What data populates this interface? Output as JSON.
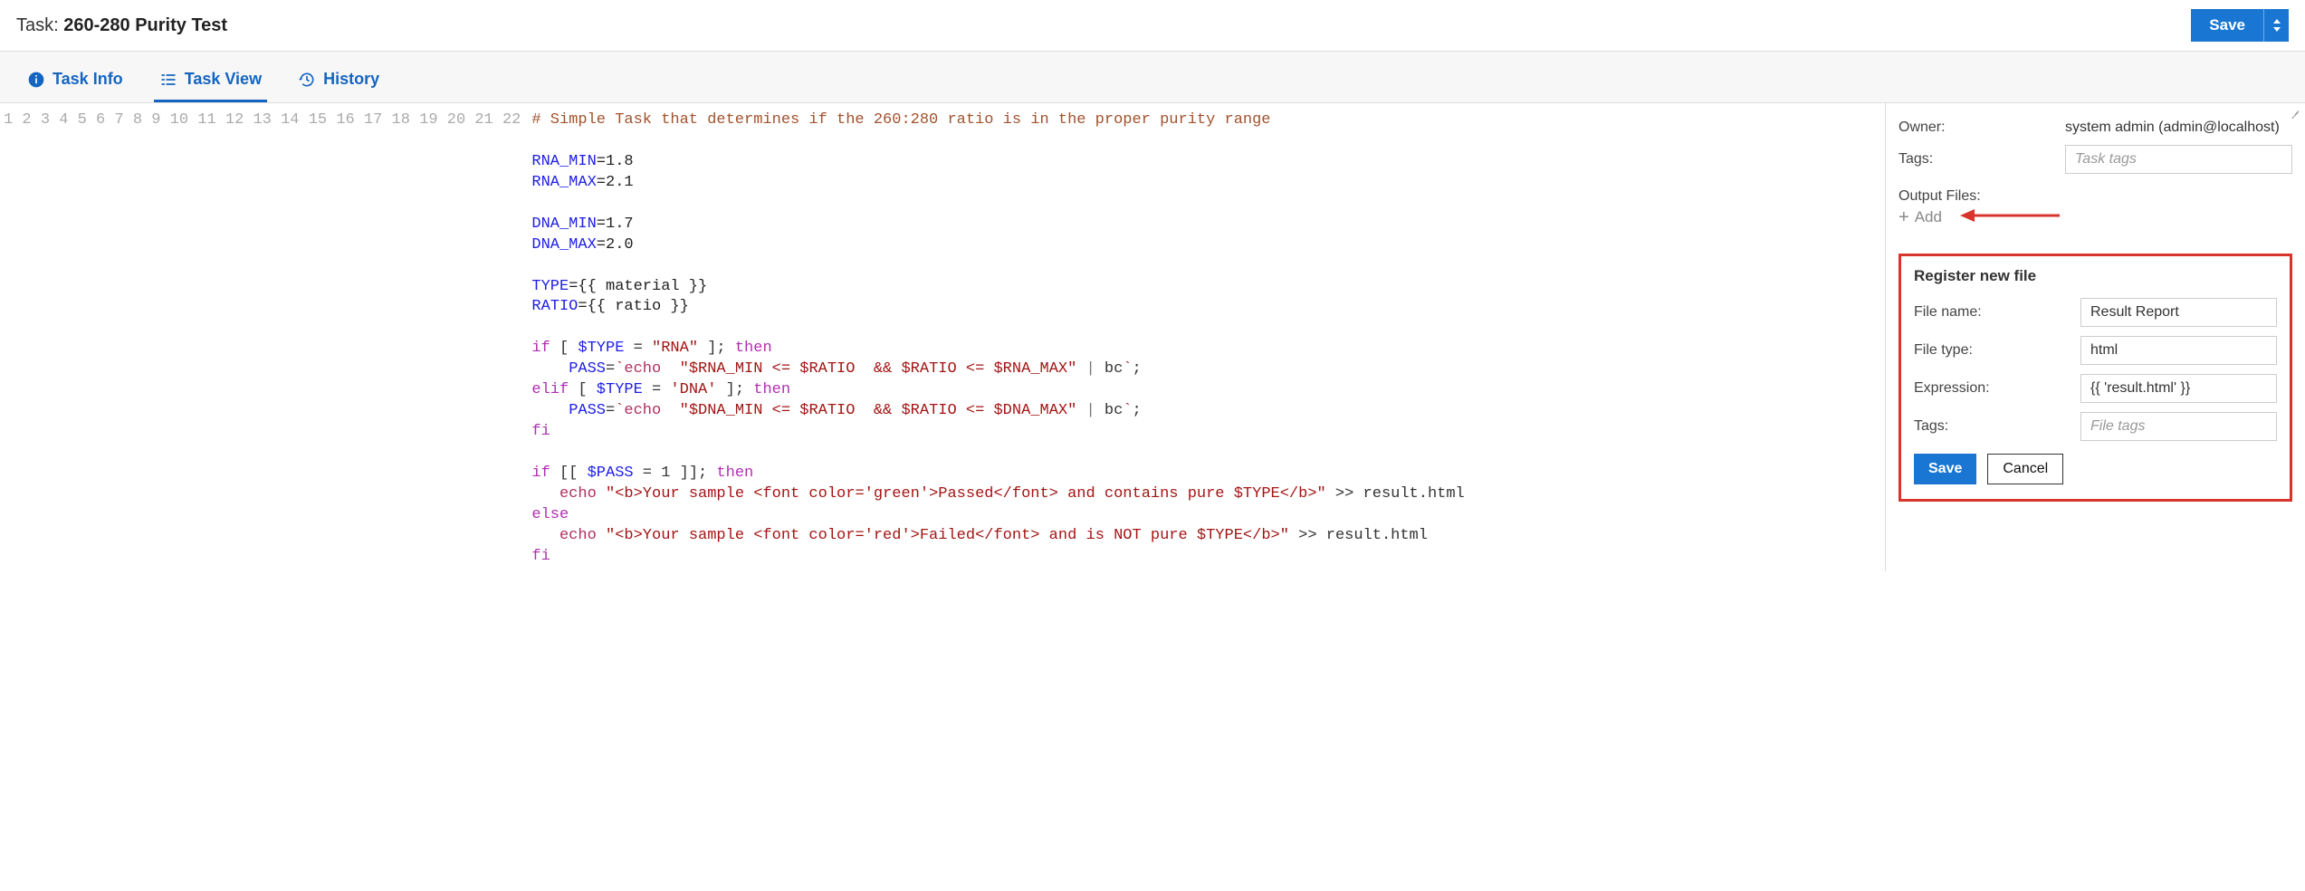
{
  "header": {
    "task_label": "Task:",
    "task_name": "260-280 Purity Test",
    "save_label": "Save"
  },
  "tabs": {
    "info": "Task Info",
    "view": "Task View",
    "history": "History"
  },
  "code": {
    "l1_comment": "# Simple Task that determines if the 260:280 ratio is in the proper purity range",
    "l3_var": "RNA_MIN",
    "l3_val": "=1.8",
    "l4_var": "RNA_MAX",
    "l4_val": "=2.1",
    "l6_var": "DNA_MIN",
    "l6_val": "=1.7",
    "l7_var": "DNA_MAX",
    "l7_val": "=2.0",
    "l9_var": "TYPE",
    "l9_val": "={{ material }}",
    "l10_var": "RATIO",
    "l10_val": "={{ ratio }}",
    "l12_if": "if",
    "l12_cond_a": " [ ",
    "l12_type": "$TYPE",
    "l12_eq": " = ",
    "l12_str": "\"RNA\"",
    "l12_cond_b": " ]; ",
    "l12_then": "then",
    "l13_pad": "    ",
    "l13_pass": "PASS",
    "l13_eq2": "=",
    "l13_bt1": "`",
    "l13_echo": "echo  ",
    "l13_str": "\"$RNA_MIN <= $RATIO  && $RATIO <= $RNA_MAX\"",
    "l13_pipe": " | ",
    "l13_bc": "bc",
    "l13_bt2": "`",
    "l13_semi": ";",
    "l14_elif": "elif",
    "l14_cond_a": " [ ",
    "l14_type": "$TYPE",
    "l14_eq": " = ",
    "l14_str": "'DNA'",
    "l14_cond_b": " ]; ",
    "l14_then": "then",
    "l15_pad": "    ",
    "l15_pass": "PASS",
    "l15_eq2": "=",
    "l15_bt1": "`",
    "l15_echo": "echo  ",
    "l15_str": "\"$DNA_MIN <= $RATIO  && $RATIO <= $DNA_MAX\"",
    "l15_pipe": " | ",
    "l15_bc": "bc",
    "l15_bt2": "`",
    "l15_semi": ";",
    "l16_fi": "fi",
    "l18_if": "if",
    "l18_cond": " [[ ",
    "l18_pass": "$PASS",
    "l18_eq": " = 1 ]]; ",
    "l18_then": "then",
    "l19_pad": "   ",
    "l19_echo": "echo ",
    "l19_str": "\"<b>Your sample <font color='green'>Passed</font> and contains pure $TYPE</b>\"",
    "l19_out": " >> result.html",
    "l20_else": "else",
    "l21_pad": "   ",
    "l21_echo": "echo ",
    "l21_str": "\"<b>Your sample <font color='red'>Failed</font> and is NOT pure $TYPE</b>\"",
    "l21_out": " >> result.html",
    "l22_fi": "fi"
  },
  "sidebar": {
    "owner_label": "Owner:",
    "owner_value": "system admin (admin@localhost)",
    "tags_label": "Tags:",
    "tags_placeholder": "Task tags",
    "output_label": "Output Files:",
    "add_label": "Add"
  },
  "panel": {
    "title": "Register new file",
    "filename_label": "File name:",
    "filename_value": "Result Report",
    "filetype_label": "File type:",
    "filetype_value": "html",
    "expression_label": "Expression:",
    "expression_value": "{{ 'result.html' }}",
    "tags_label": "Tags:",
    "tags_placeholder": "File tags",
    "save_label": "Save",
    "cancel_label": "Cancel"
  },
  "gutter": [
    "1",
    "2",
    "3",
    "4",
    "5",
    "6",
    "7",
    "8",
    "9",
    "10",
    "11",
    "12",
    "13",
    "14",
    "15",
    "16",
    "17",
    "18",
    "19",
    "20",
    "21",
    "22"
  ]
}
